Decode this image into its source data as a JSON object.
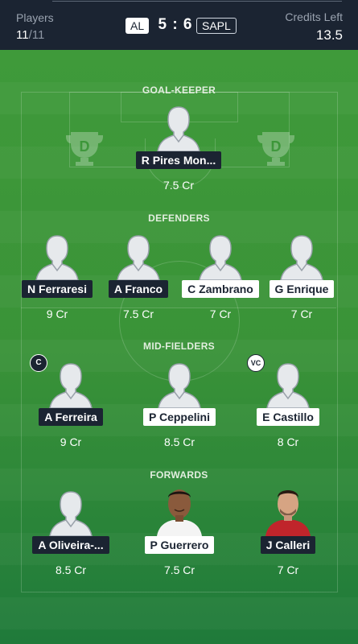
{
  "header": {
    "players_label": "Players",
    "players_count": "11",
    "players_total": "/11",
    "team_a": "AL",
    "score": "5 : 6",
    "team_b": "SAPL",
    "credits_label": "Credits Left",
    "credits_value": "13.5"
  },
  "sections": {
    "goalkeeper": "GOAL-KEEPER",
    "defenders": "DEFENDERS",
    "midfielders": "MID-FIELDERS",
    "forwards": "FORWARDS"
  },
  "players": {
    "gk1": {
      "name": "R Pires Mon...",
      "credit": "7.5 Cr"
    },
    "def1": {
      "name": "N Ferraresi",
      "credit": "9 Cr"
    },
    "def2": {
      "name": "A Franco",
      "credit": "7.5 Cr"
    },
    "def3": {
      "name": "C Zambrano",
      "credit": "7 Cr"
    },
    "def4": {
      "name": "G Enrique",
      "credit": "7 Cr"
    },
    "mid1": {
      "name": "A Ferreira",
      "credit": "9 Cr",
      "badge": "C"
    },
    "mid2": {
      "name": "P Ceppelini",
      "credit": "8.5 Cr"
    },
    "mid3": {
      "name": "E Castillo",
      "credit": "8 Cr",
      "badge": "VC"
    },
    "fwd1": {
      "name": "A Oliveira-...",
      "credit": "8.5 Cr"
    },
    "fwd2": {
      "name": "P Guerrero",
      "credit": "7.5 Cr"
    },
    "fwd3": {
      "name": "J Calleri",
      "credit": "7 Cr"
    }
  },
  "colors": {
    "team_dark": "#1b2432",
    "team_light": "#ffffff",
    "pitch": "#3a9338"
  }
}
